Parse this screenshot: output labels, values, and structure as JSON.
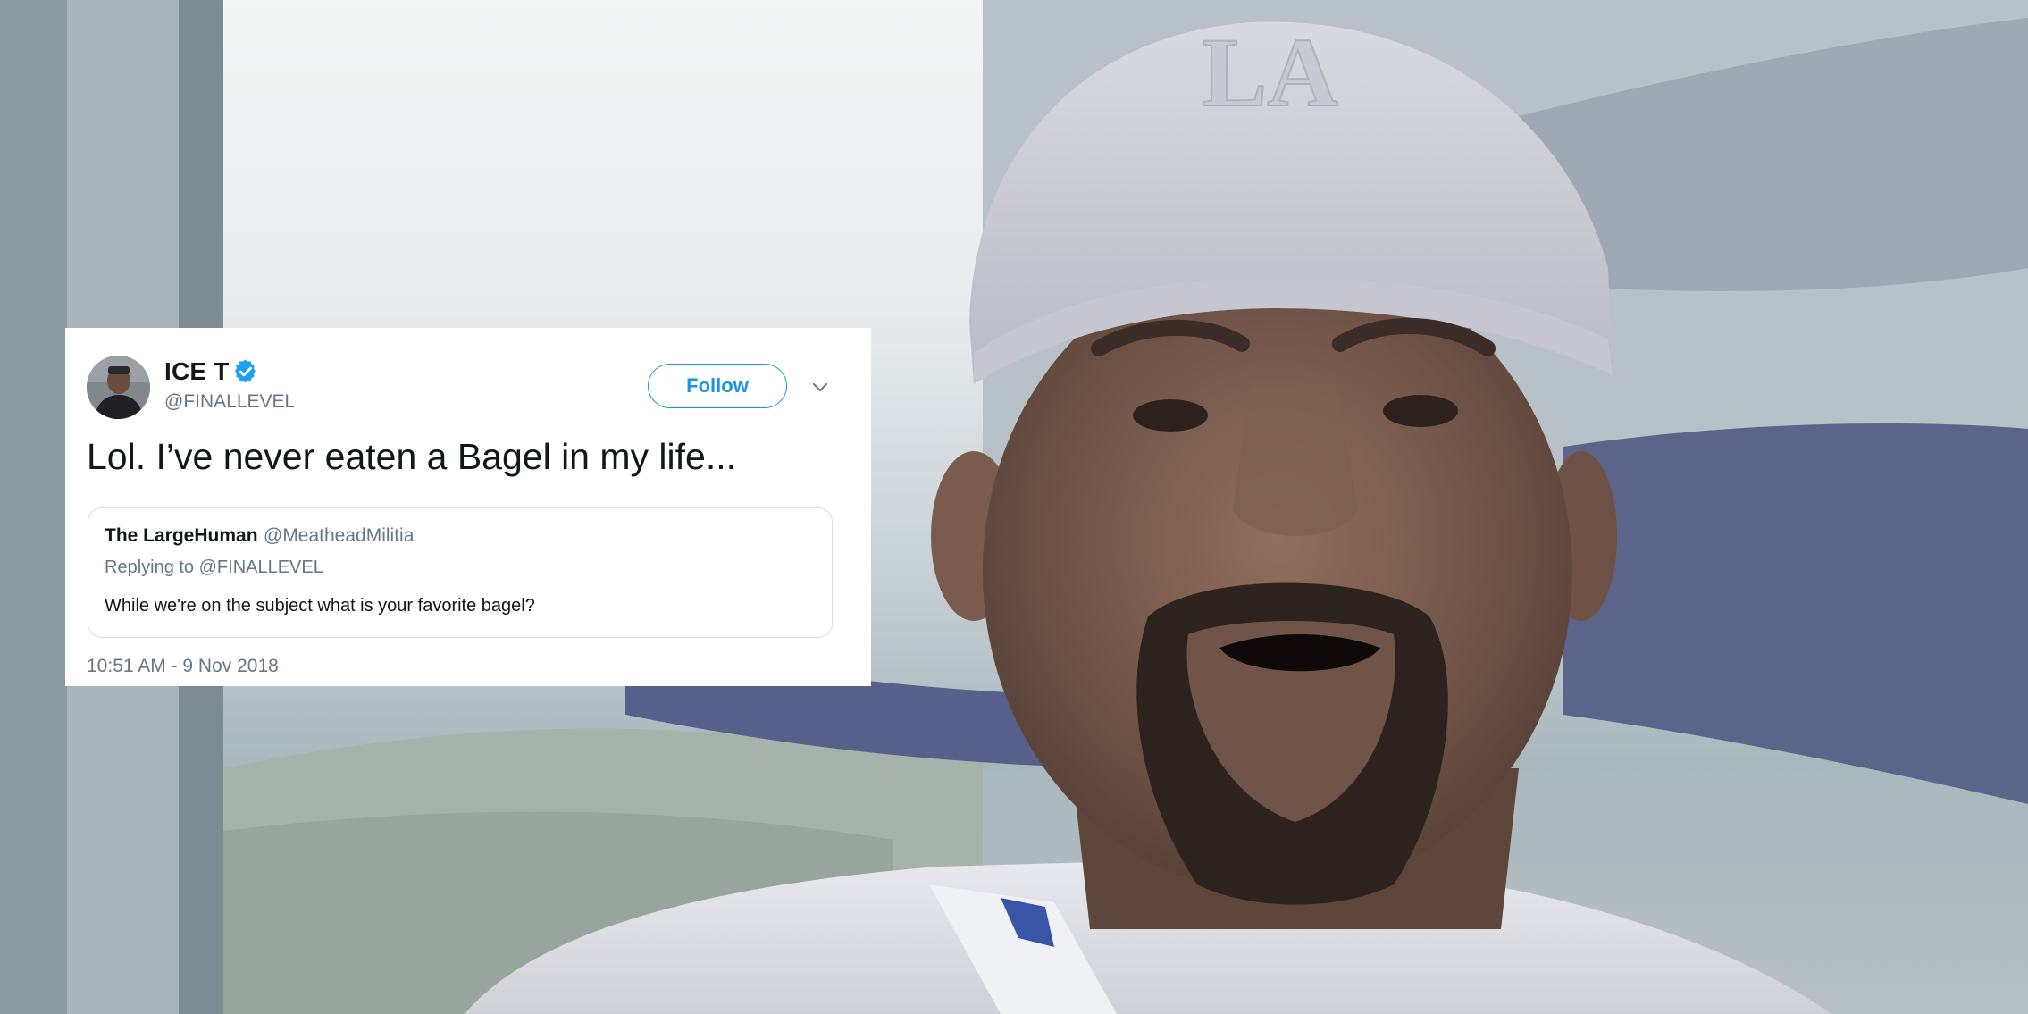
{
  "tweet": {
    "display_name": "ICE T",
    "handle": "@FINALLEVEL",
    "follow_label": "Follow",
    "text": "Lol. I’ve never eaten a Bagel in my life...",
    "timestamp": "10:51 AM - 9 Nov 2018",
    "quoted": {
      "display_name": "The LargeHuman",
      "handle": "@MeatheadMilitia",
      "reply_line": "Replying to @FINALLEVEL",
      "text": "While we're on the subject what is your favorite bagel?"
    }
  },
  "photo": {
    "cap_logo": "LA"
  },
  "colors": {
    "accent": "#1b95e0",
    "verified": "#1da1f2",
    "secondary_text": "#657786",
    "primary_text": "#14171a"
  },
  "icons": {
    "verified": "verified-badge-icon",
    "caret": "chevron-down-icon"
  }
}
